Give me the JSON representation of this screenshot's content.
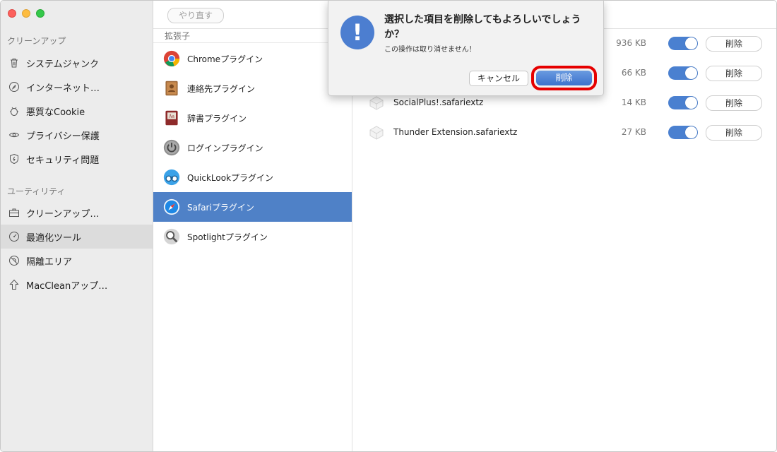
{
  "toolbar": {
    "redo_label": "やり直す"
  },
  "sidebar": {
    "section_cleanup": "クリーンアップ",
    "section_utility": "ユーティリティ",
    "cleanup_items": [
      {
        "label": "システムジャンク",
        "icon": "trash-icon"
      },
      {
        "label": "インターネット…",
        "icon": "compass-icon"
      },
      {
        "label": "悪質なCookie",
        "icon": "bug-icon"
      },
      {
        "label": "プライバシー保護",
        "icon": "eye-icon"
      },
      {
        "label": "セキュリティ問題",
        "icon": "shield-icon"
      }
    ],
    "utility_items": [
      {
        "label": "クリーンアップ…",
        "icon": "briefcase-icon"
      },
      {
        "label": "最適化ツール",
        "icon": "gauge-icon"
      },
      {
        "label": "隔離エリア",
        "icon": "quarantine-icon"
      },
      {
        "label": "MacCleanアップ…",
        "icon": "upload-arrow-icon"
      }
    ]
  },
  "plugins": {
    "header": "拡張子",
    "items": [
      {
        "label": "Chromeプラグイン",
        "icon": "chrome-icon"
      },
      {
        "label": "連絡先プラグイン",
        "icon": "contacts-icon"
      },
      {
        "label": "辞書プラグイン",
        "icon": "dictionary-icon"
      },
      {
        "label": "ログインプラグイン",
        "icon": "power-icon"
      },
      {
        "label": "QuickLookプラグイン",
        "icon": "binoculars-icon"
      },
      {
        "label": "Safariプラグイン",
        "icon": "safari-icon"
      },
      {
        "label": "Spotlightプラグイン",
        "icon": "magnifier-icon"
      }
    ],
    "selected_index": 5
  },
  "extensions": [
    {
      "name": "",
      "size": "936 KB",
      "enabled": true,
      "delete_label": "削除"
    },
    {
      "name": "",
      "size": "66 KB",
      "enabled": true,
      "delete_label": "削除"
    },
    {
      "name": "SocialPlus!.safariextz",
      "size": "14 KB",
      "enabled": true,
      "delete_label": "削除"
    },
    {
      "name": "Thunder Extension.safariextz",
      "size": "27 KB",
      "enabled": true,
      "delete_label": "削除"
    }
  ],
  "alert": {
    "title": "選択した項目を削除してもよろしいでしょうか？",
    "message": "この操作は取り消せません！",
    "cancel_label": "キャンセル",
    "confirm_label": "削除",
    "icon": "exclamation-icon"
  },
  "colors": {
    "accent": "#4f81c7",
    "highlight": "#e60000"
  }
}
